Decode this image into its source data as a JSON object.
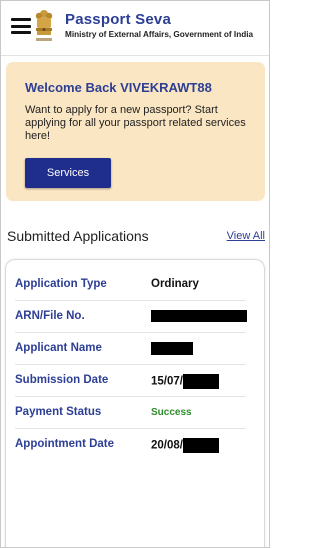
{
  "header": {
    "title": "Passport  Seva",
    "subtitle": "Ministry of External Affairs, Government of India",
    "emblem_text": "सत्यमेव जयते"
  },
  "welcome": {
    "heading": "Welcome Back VIVEKRAWT88",
    "message": "Want to apply for a new passport? Start applying for all your passport related services here!",
    "services_label": "Services"
  },
  "applications": {
    "section_title": "Submitted Applications",
    "view_all_label": "View All",
    "rows": [
      {
        "label": "Application Type",
        "value": "Ordinary"
      },
      {
        "label": "ARN/File No.",
        "value": ""
      },
      {
        "label": "Applicant Name",
        "value": ""
      },
      {
        "label": "Submission Date",
        "value": "15/07/"
      },
      {
        "label": "Payment Status",
        "value": "Success"
      },
      {
        "label": "Appointment Date",
        "value": "20/08/"
      }
    ]
  },
  "colors": {
    "brand_blue": "#2c3f94",
    "button_blue": "#1f2e8c",
    "card_background": "#fbe6c3",
    "success_green": "#2e8b2e"
  },
  "icons": [
    "hamburger-menu-icon",
    "national-emblem-logo"
  ]
}
